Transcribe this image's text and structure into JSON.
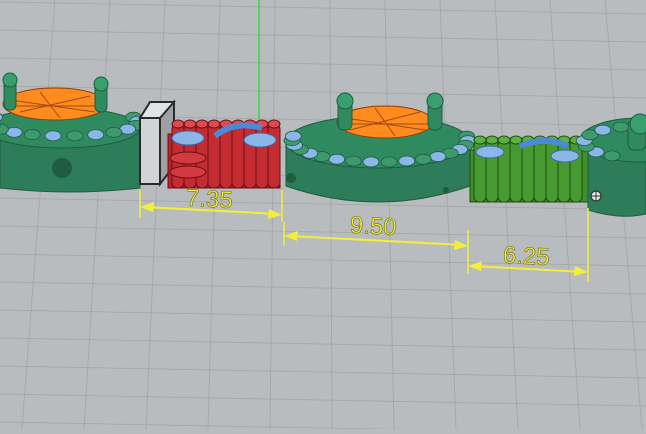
{
  "viewport": {
    "background": "#b9bcbe",
    "grid_color": "#a6a9ac",
    "axis_color": "#2bd62b"
  },
  "colors": {
    "green_part": "#2e7d5a",
    "green_part_dark": "#1f5c40",
    "bright_green_part": "#3f8f2a",
    "red_part": "#b8242a",
    "orange_infill": "#ff8a1e",
    "blue_support": "#8ab6e8",
    "dimension_yellow": "#f4ee3a",
    "gray_block": "#c4c6c8"
  },
  "dimensions": [
    {
      "label": "7.35"
    },
    {
      "label": "9.50"
    },
    {
      "label": "6.25"
    }
  ],
  "icons": {
    "cursor": "crosshair-cursor-icon"
  }
}
